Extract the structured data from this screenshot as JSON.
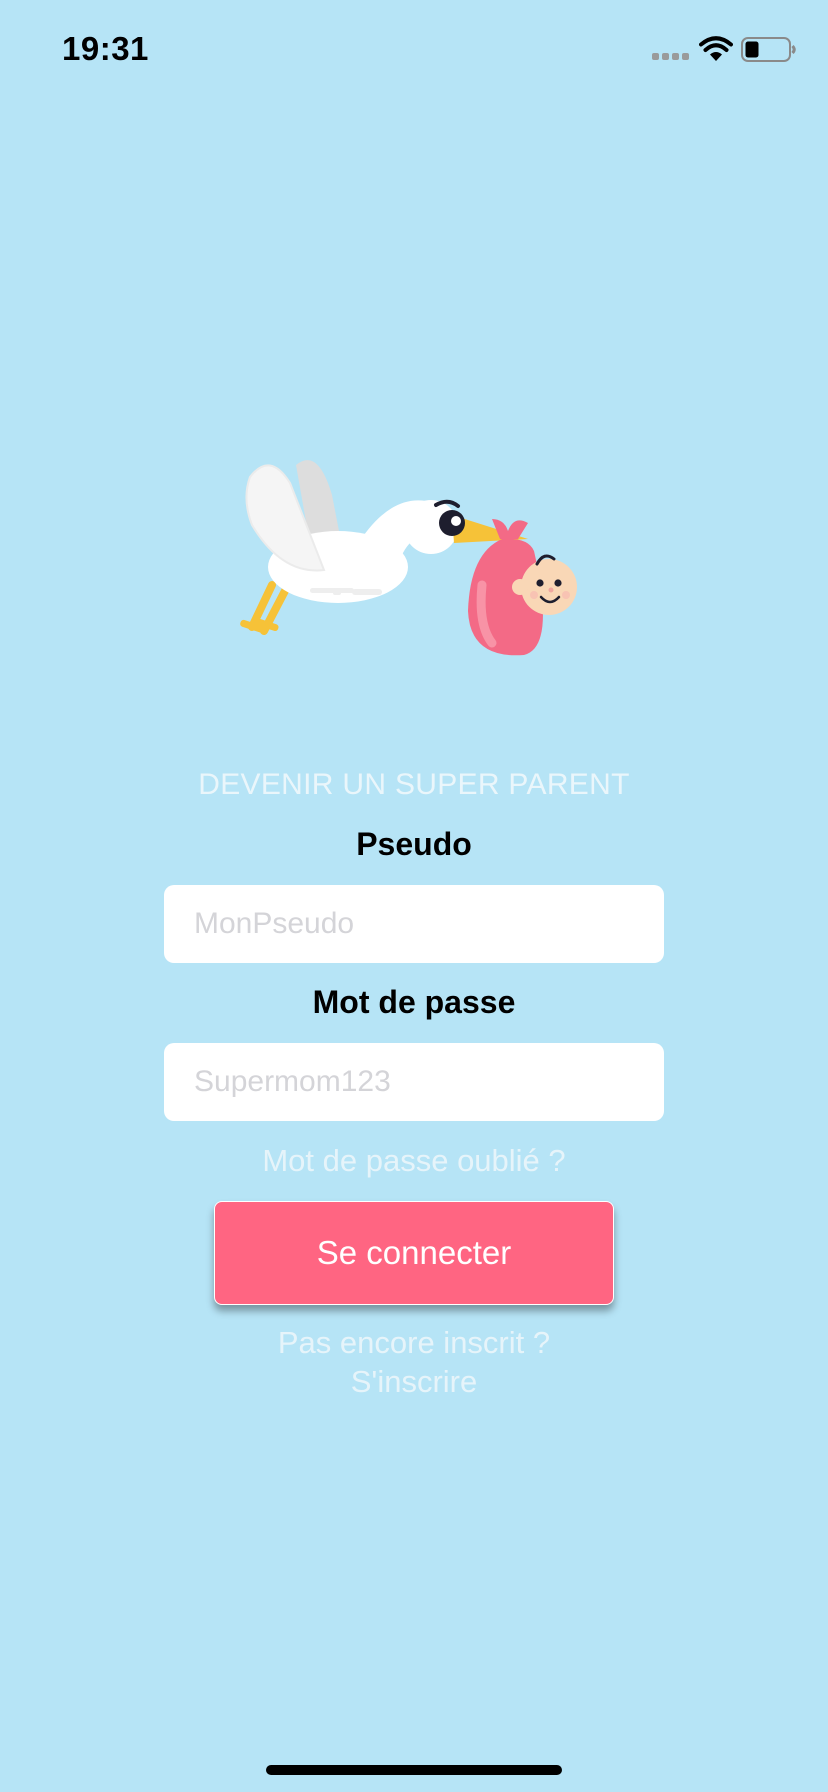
{
  "status_bar": {
    "time": "19:31",
    "icons": [
      "cellular-signal-icon",
      "wifi-icon",
      "battery-icon"
    ]
  },
  "illustration": {
    "icon": "stork-carrying-baby-illustration"
  },
  "login": {
    "tagline": "DEVENIR UN SUPER PARENT",
    "pseudo_label": "Pseudo",
    "pseudo_placeholder": "MonPseudo",
    "pseudo_value": "",
    "password_label": "Mot de passe",
    "password_placeholder": "Supermom123",
    "password_value": "",
    "forgot_password": "Mot de passe oublié ?",
    "connect_button": "Se connecter",
    "not_registered": "Pas encore inscrit ?",
    "signup_link": "S'inscrire"
  },
  "colors": {
    "background": "#b6e4f6",
    "accent_button": "#ff6582",
    "input_background": "#ffffff",
    "secondary_text": "#e6f4fa"
  }
}
